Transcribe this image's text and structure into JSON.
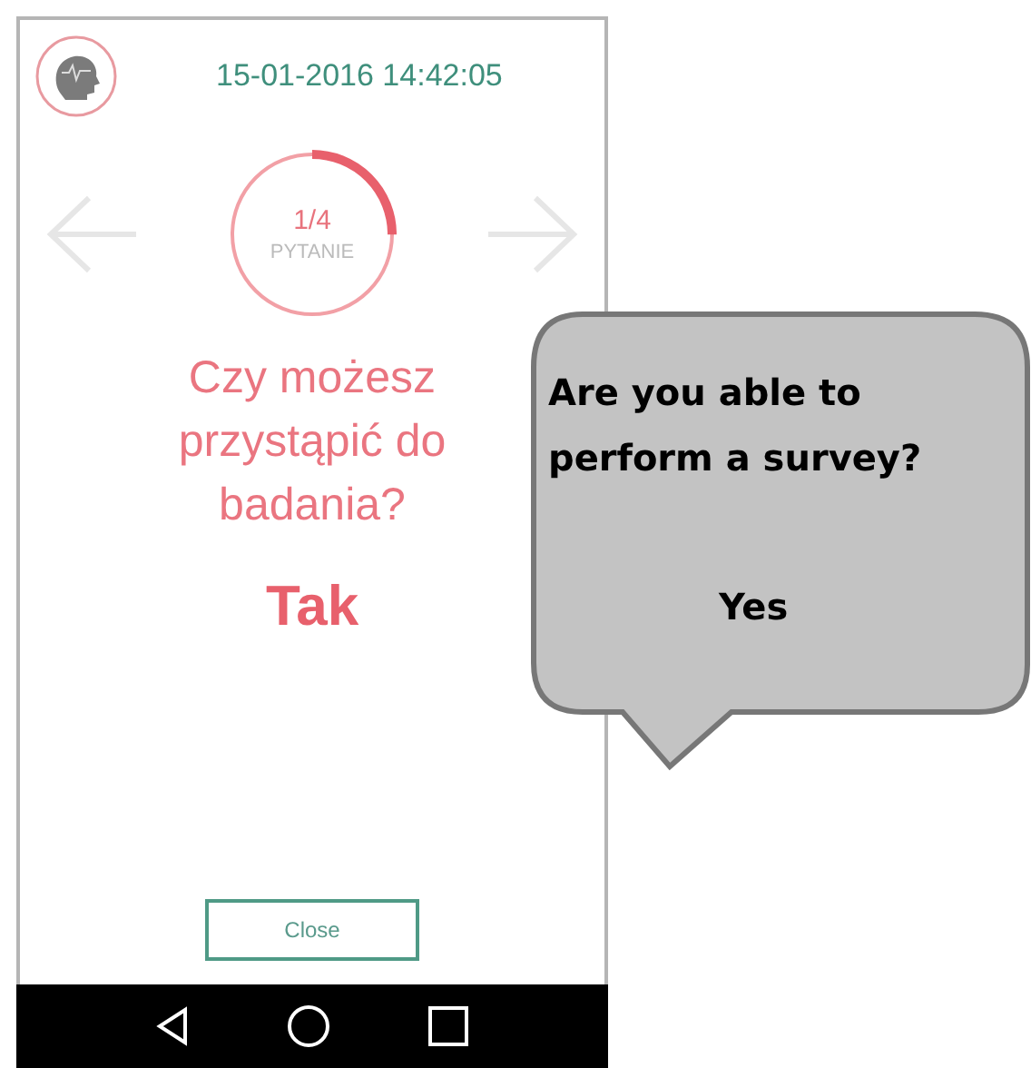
{
  "header": {
    "date_time": "15-01-2016 14:42:05"
  },
  "question": {
    "counter": "1/4",
    "counter_label": "PYTANIE",
    "level": 0.25,
    "text": "Czy możesz przystąpić do badania?",
    "answer": "Tak"
  },
  "close_button": {
    "label": "Close"
  },
  "annotation": {
    "question": "Are you able to perform a survey?",
    "answer": "Yes"
  }
}
